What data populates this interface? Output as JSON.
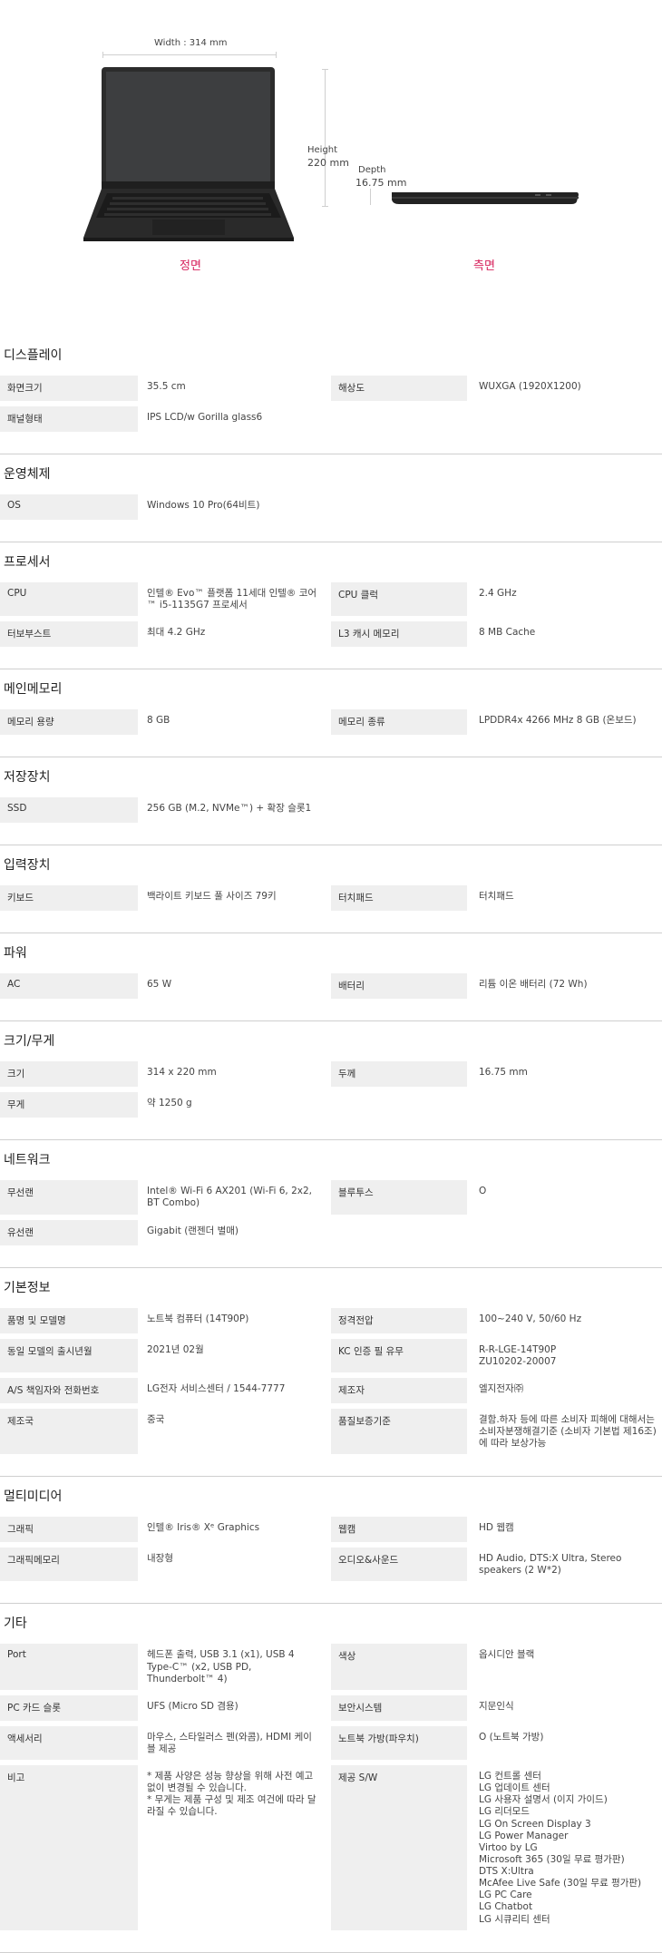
{
  "hero": {
    "width_label": "Width : 314 mm",
    "height_label_1": "Height",
    "height_label_2": "220 mm",
    "depth_label_1": "Depth",
    "depth_label_2": "16.75 mm",
    "front_label": "정면",
    "side_label": "측면"
  },
  "sections": [
    {
      "title": "디스플레이",
      "rows": [
        [
          {
            "label": "화면크기",
            "value": "35.5 cm"
          },
          {
            "label": "해상도",
            "value": "WUXGA (1920X1200)"
          }
        ],
        [
          {
            "label": "패널형태",
            "value": "IPS LCD/w Gorilla glass6"
          }
        ]
      ]
    },
    {
      "title": "운영체제",
      "rows": [
        [
          {
            "label": "OS",
            "value": "Windows 10 Pro(64비트)"
          }
        ]
      ]
    },
    {
      "title": "프로세서",
      "rows": [
        [
          {
            "label": "CPU",
            "value": "인텔® Evo™ 플랫폼 11세대 인텔® 코어™ i5-1135G7 프로세서"
          },
          {
            "label": "CPU 클럭",
            "value": "2.4 GHz"
          }
        ],
        [
          {
            "label": "터보부스트",
            "value": "최대 4.2 GHz"
          },
          {
            "label": "L3 캐시 메모리",
            "value": "8 MB Cache"
          }
        ]
      ]
    },
    {
      "title": "메인메모리",
      "rows": [
        [
          {
            "label": "메모리 용량",
            "value": "8 GB"
          },
          {
            "label": "메모리 종류",
            "value": "LPDDR4x 4266 MHz 8 GB (온보드)"
          }
        ]
      ]
    },
    {
      "title": "저장장치",
      "rows": [
        [
          {
            "label": "SSD",
            "value": "256 GB (M.2, NVMe™) + 확장 슬롯1"
          }
        ]
      ]
    },
    {
      "title": "입력장치",
      "rows": [
        [
          {
            "label": "키보드",
            "value": "백라이트 키보드 풀 사이즈 79키"
          },
          {
            "label": "터치패드",
            "value": "터치패드"
          }
        ]
      ]
    },
    {
      "title": "파워",
      "rows": [
        [
          {
            "label": "AC",
            "value": "65 W"
          },
          {
            "label": "배터리",
            "value": "리튬 이온 배터리 (72 Wh)"
          }
        ]
      ]
    },
    {
      "title": "크기/무게",
      "rows": [
        [
          {
            "label": "크기",
            "value": "314 x 220 mm"
          },
          {
            "label": "두께",
            "value": "16.75 mm"
          }
        ],
        [
          {
            "label": "무게",
            "value": "약 1250 g"
          }
        ]
      ]
    },
    {
      "title": "네트워크",
      "rows": [
        [
          {
            "label": "무선랜",
            "value": "Intel® Wi-Fi 6 AX201 (Wi-Fi 6, 2x2, BT Combo)"
          },
          {
            "label": "블루투스",
            "value": "O"
          }
        ],
        [
          {
            "label": "유선랜",
            "value": "Gigabit (랜젠더 별매)"
          }
        ]
      ]
    },
    {
      "title": "기본정보",
      "rows": [
        [
          {
            "label": "품명 및 모델명",
            "value": "노트북 컴퓨터 (14T90P)"
          },
          {
            "label": "정격전압",
            "value": "100~240 V, 50/60 Hz"
          }
        ],
        [
          {
            "label": "동일 모델의 출시년월",
            "value": "2021년 02월"
          },
          {
            "label": "KC 인증 필 유무",
            "value": "R-R-LGE-14T90P\nZU10202-20007"
          }
        ],
        [
          {
            "label": "A/S 책임자와 전화번호",
            "value": "LG전자 서비스센터 / 1544-7777"
          },
          {
            "label": "제조자",
            "value": "엘지전자㈜"
          }
        ],
        [
          {
            "label": "제조국",
            "value": "중국"
          },
          {
            "label": "품질보증기준",
            "value": "결함.하자 등에 따른 소비자 피해에 대해서는 소비자분쟁해결기준 (소비자 기본법 제16조)에 따라 보상가능"
          }
        ]
      ]
    },
    {
      "title": "멀티미디어",
      "rows": [
        [
          {
            "label": "그래픽",
            "value": "인텔® Iris® Xᵉ Graphics"
          },
          {
            "label": "웹캠",
            "value": "HD 웹캠"
          }
        ],
        [
          {
            "label": "그래픽메모리",
            "value": "내장형"
          },
          {
            "label": "오디오&사운드",
            "value": "HD Audio, DTS:X Ultra, Stereo speakers (2 W*2)"
          }
        ]
      ]
    },
    {
      "title": "기타",
      "rows": [
        [
          {
            "label": "Port",
            "value": "헤드폰 출력, USB 3.1 (x1), USB 4 Type-C™ (x2, USB PD, Thunderbolt™ 4)"
          },
          {
            "label": "색상",
            "value": "옵시디안 블랙"
          }
        ],
        [
          {
            "label": "PC 카드 슬롯",
            "value": "UFS (Micro SD 겸용)"
          },
          {
            "label": "보안시스템",
            "value": "지문인식"
          }
        ],
        [
          {
            "label": "액세서리",
            "value": "마우스, 스타일러스 펜(와콤), HDMI 케이블 제공"
          },
          {
            "label": "노트북 가방(파우치)",
            "value": "O (노트북 가방)"
          }
        ],
        [
          {
            "label": "비고",
            "value": "* 제품 사양은 성능 향상을 위해 사전 예고없이 변경될 수 있습니다.\n* 무게는 제품 구성 및 제조 여건에 따라 달라질 수 있습니다."
          },
          {
            "label": "제공 S/W",
            "value": "LG 컨트롤 센터\nLG 업데이트 센터\nLG 사용자 설명서 (이지 가이드)\nLG 리더모드\nLG On Screen Display 3\nLG Power Manager\nVirtoo by LG\nMicrosoft 365 (30일 무료 평가판)\nDTS X:Ultra\nMcAfee Live Safe (30일 무료 평가판)\nLG PC Care\nLG Chatbot\nLG 시큐리티 센터"
          }
        ]
      ]
    }
  ]
}
